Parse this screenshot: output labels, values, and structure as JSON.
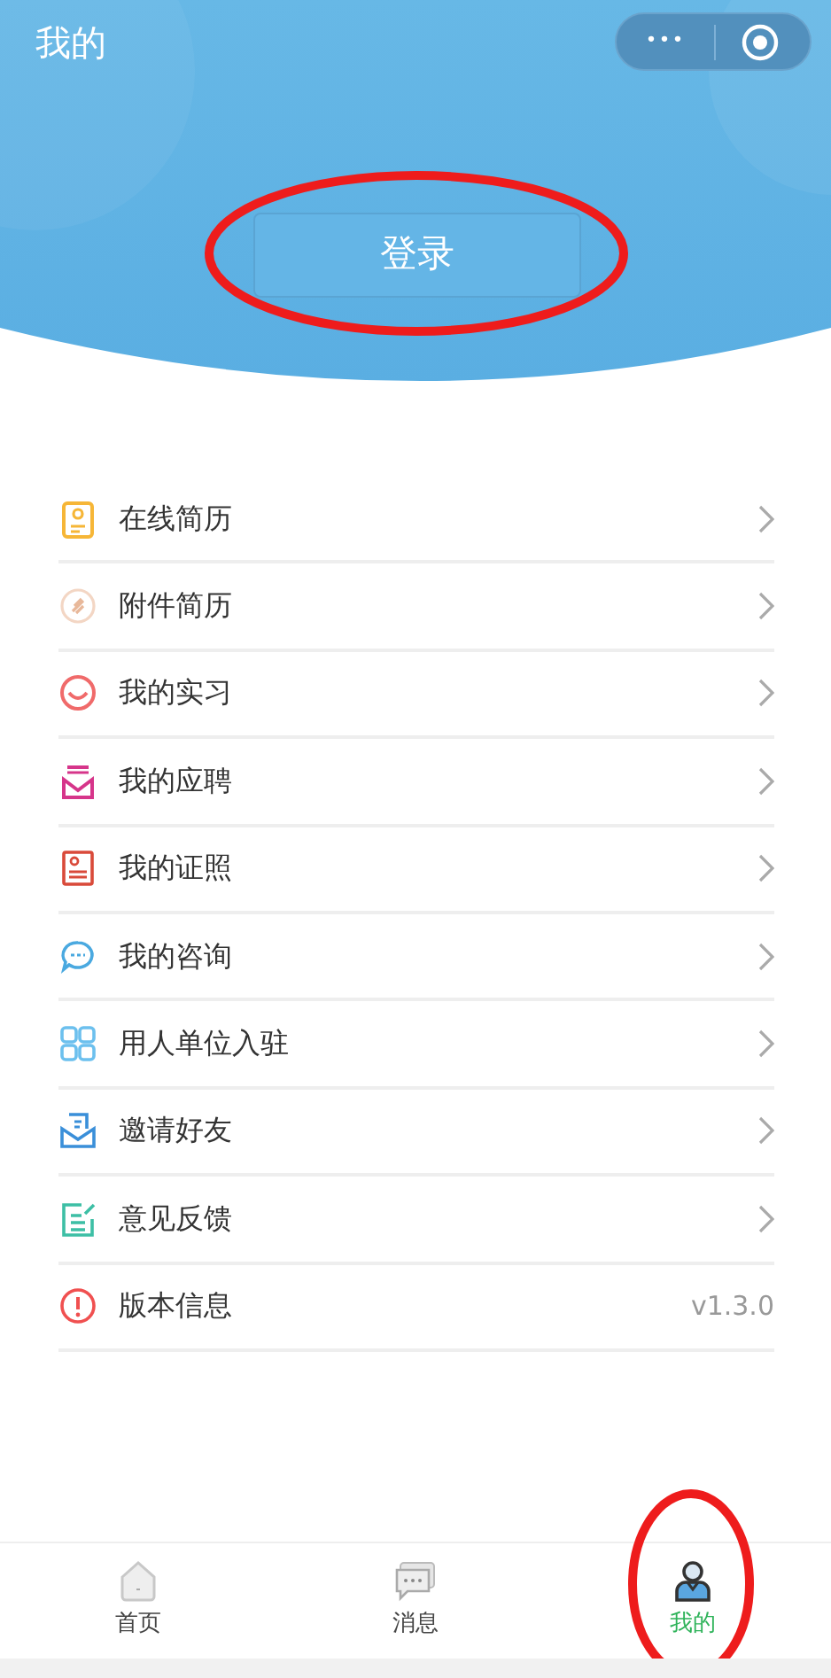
{
  "header": {
    "title": "我的",
    "capsule": {
      "more": "•••"
    },
    "login_button": {
      "label": "登录",
      "circled": true
    }
  },
  "menu": [
    {
      "label": "在线简历",
      "kind": "link"
    },
    {
      "label": "附件简历",
      "kind": "link"
    },
    {
      "label": "我的实习",
      "kind": "link"
    },
    {
      "label": "我的应聘",
      "kind": "link"
    },
    {
      "label": "我的证照",
      "kind": "link"
    },
    {
      "label": "我的咨询",
      "kind": "link"
    },
    {
      "label": "用人单位入驻",
      "kind": "link"
    },
    {
      "label": "邀请好友",
      "kind": "link"
    },
    {
      "label": "意见反馈",
      "kind": "link"
    },
    {
      "label": "版本信息",
      "kind": "info",
      "value": "v1.3.0"
    }
  ],
  "tab_bar": [
    {
      "label": "首页",
      "selected": false,
      "circled": false
    },
    {
      "label": "消息",
      "selected": false,
      "circled": false
    },
    {
      "label": "我的",
      "selected": true,
      "circled": true
    }
  ]
}
